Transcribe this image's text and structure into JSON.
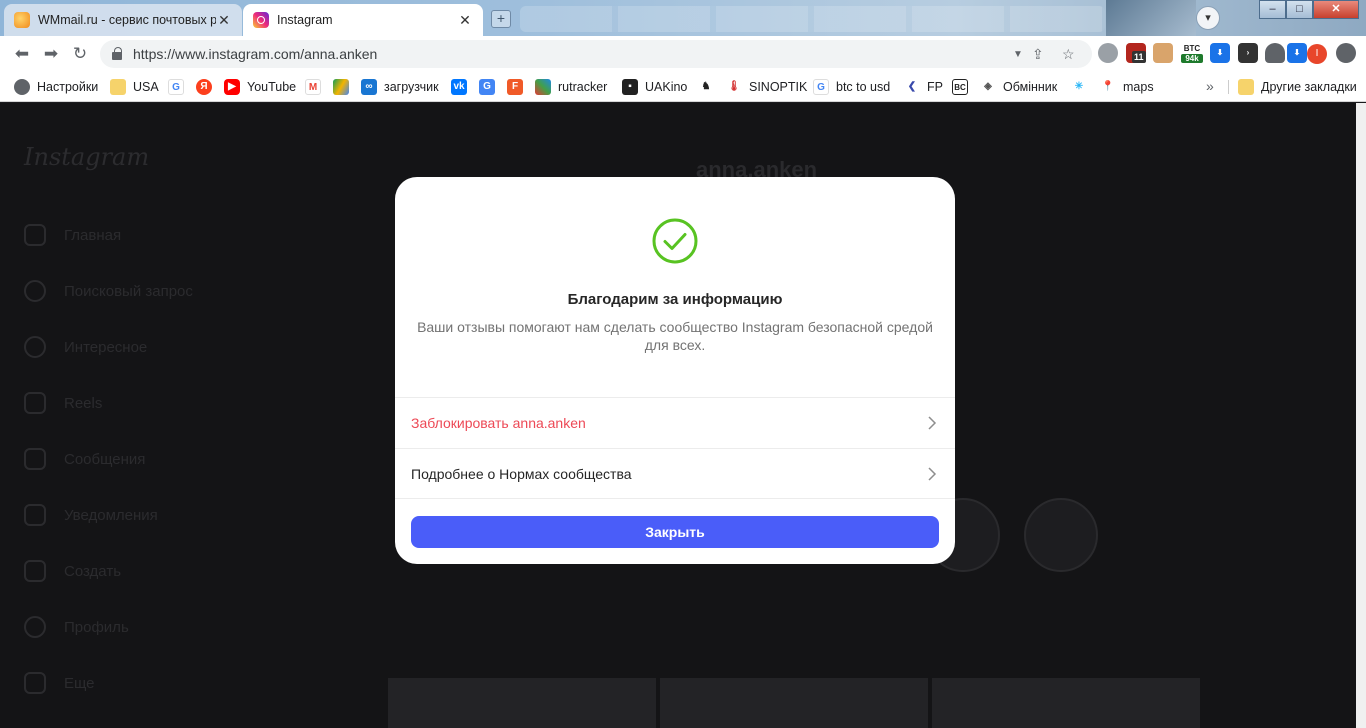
{
  "tabs": [
    {
      "title": "WMmail.ru - сервис почтовых рас",
      "active": false
    },
    {
      "title": "Instagram",
      "active": true
    }
  ],
  "window": {
    "minimize": "–",
    "maximize": "□",
    "close": "✕"
  },
  "address_bar": {
    "url": "https://www.instagram.com/anna.anken"
  },
  "extensions": {
    "badge_count": "11",
    "btc_label": "BTC",
    "btc_value": "94k",
    "profile_initial": "I"
  },
  "bookmarks": [
    {
      "label": "Настройки",
      "icon": "gear-icon"
    },
    {
      "label": "USA",
      "icon": "folder-icon"
    },
    {
      "label": "",
      "icon": "google-icon"
    },
    {
      "label": "",
      "icon": "yandex-icon"
    },
    {
      "label": "YouTube",
      "icon": "youtube-icon"
    },
    {
      "label": "",
      "icon": "gmail-icon"
    },
    {
      "label": "",
      "icon": "drive-icon"
    },
    {
      "label": "загрузчик",
      "icon": "infinity-icon"
    },
    {
      "label": "",
      "icon": "vk-icon"
    },
    {
      "label": "",
      "icon": "translate-icon"
    },
    {
      "label": "",
      "icon": "f-icon"
    },
    {
      "label": "rutracker",
      "icon": "rutracker-icon"
    },
    {
      "label": "UAKino",
      "icon": "uakino-icon"
    },
    {
      "label": "",
      "icon": "chess-icon"
    },
    {
      "label": "SINOPTIK",
      "icon": "thermometer-icon"
    },
    {
      "label": "btc to usd",
      "icon": "google-icon"
    },
    {
      "label": "FP",
      "icon": "fp-icon"
    },
    {
      "label": "",
      "icon": "bc-icon"
    },
    {
      "label": "Обмінник",
      "icon": "exchange-icon"
    },
    {
      "label": "",
      "icon": "star-icon"
    },
    {
      "label": "maps",
      "icon": "maps-icon"
    }
  ],
  "bookmarks_more": "»",
  "other_bookmarks": "Другие закладки",
  "background": {
    "logo": "Instagram",
    "profile_name": "anna.anken",
    "sidebar": [
      "Главная",
      "Поисковый запрос",
      "Интересное",
      "Reels",
      "Сообщения",
      "Уведомления",
      "Создать",
      "Профиль",
      "Еще"
    ]
  },
  "modal": {
    "title": "Благодарим за информацию",
    "subtitle": "Ваши отзывы помогают нам сделать сообщество Instagram безопасной средой для всех.",
    "block_label": "Заблокировать anna.anken",
    "rules_label": "Подробнее о Нормах сообщества",
    "close_label": "Закрыть",
    "accent_color": "#4a5df9",
    "danger_color": "#ed4956",
    "check_color": "#58c322"
  }
}
